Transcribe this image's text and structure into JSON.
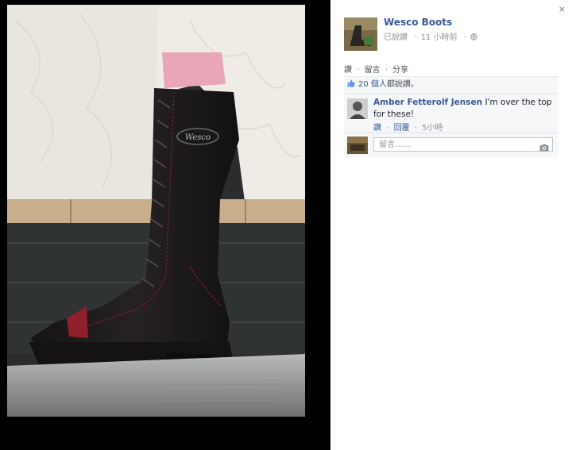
{
  "post": {
    "page_name": "Wesco Boots",
    "meta_said": "已說讚",
    "meta_time": "11 小時前",
    "globe_icon": "globe-icon"
  },
  "actions": {
    "like": "讚",
    "comment": "留言",
    "share": "分享"
  },
  "likes": {
    "count": "20 個人",
    "suffix": "都說讚。"
  },
  "comments": [
    {
      "author": "Amber Fetterolf Jensen",
      "text": "I'm over the top for these!",
      "like": "讚",
      "reply": "回覆",
      "time": "5小時"
    }
  ],
  "reply": {
    "placeholder": "留言……"
  },
  "close_label": "×",
  "photo": {
    "logo_text": "Wesco"
  }
}
